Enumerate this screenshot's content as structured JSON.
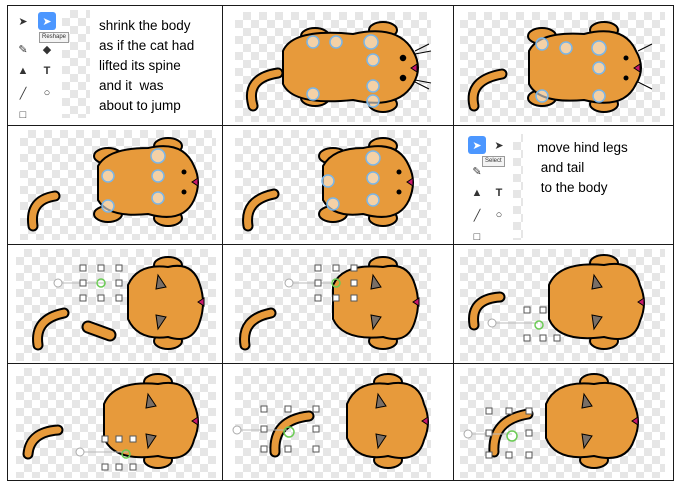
{
  "tools": {
    "reshape_tooltip": "Reshape",
    "select_tooltip": "Select",
    "text_tool_glyph": "T"
  },
  "notes": {
    "step1": "shrink the body\nas if the cat had\nlifted its spine\nand it  was\nabout to jump",
    "step2": "move hind legs\n and tail\n to the body"
  },
  "icons": [
    "select-arrow-icon",
    "reshape-icon",
    "brush-icon",
    "eraser-icon",
    "fill-icon",
    "text-icon",
    "line-icon",
    "circle-icon",
    "rectangle-icon"
  ],
  "colors": {
    "cat_fill": "#e79a3b",
    "outline": "#000000",
    "accent_blue": "#4c97ff",
    "handle_blue": "#7ab6e8",
    "handle_green": "#6ccc55",
    "nose": "#c8186b"
  }
}
